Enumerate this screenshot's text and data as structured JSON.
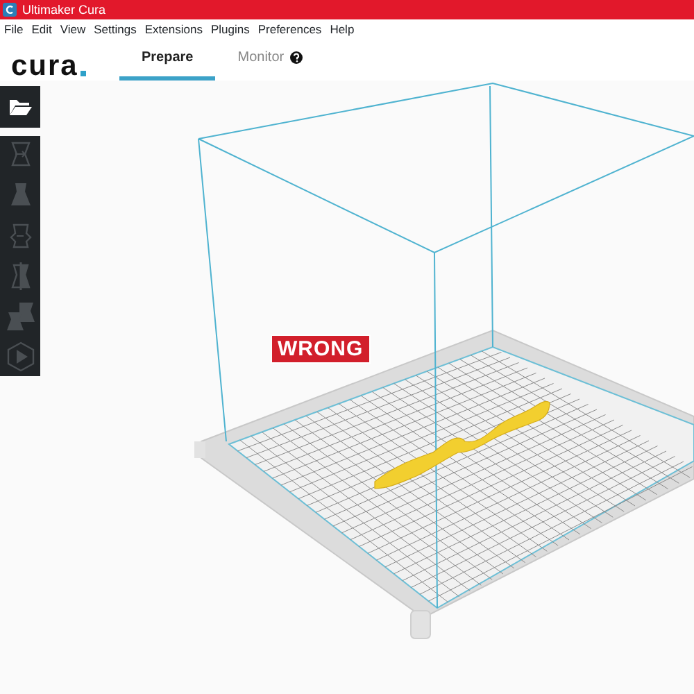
{
  "window": {
    "title": "Ultimaker Cura"
  },
  "menu": [
    "File",
    "Edit",
    "View",
    "Settings",
    "Extensions",
    "Plugins",
    "Preferences",
    "Help"
  ],
  "logo": "cura",
  "tabs": [
    {
      "label": "Prepare",
      "selected": true
    },
    {
      "label": "Monitor",
      "selected": false
    }
  ],
  "open_button": {
    "disabled": false
  },
  "tools": [
    {
      "kind": "move",
      "disabled": true
    },
    {
      "kind": "scale",
      "disabled": true
    },
    {
      "kind": "rotate",
      "disabled": true
    },
    {
      "kind": "mirror",
      "disabled": true
    },
    {
      "kind": "multiply",
      "disabled": true
    },
    {
      "kind": "support",
      "disabled": true
    }
  ],
  "overlay_label": "WRONG"
}
